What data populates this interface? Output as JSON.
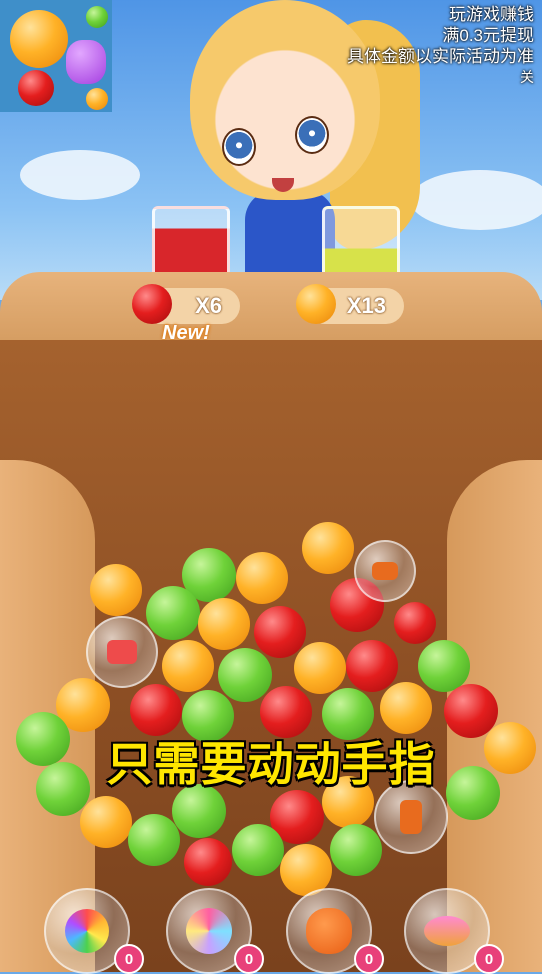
{
  "ad": {
    "line1": "玩游戏赚钱",
    "line2": "满0.3元提现",
    "line3": "具体金额以实际活动为准",
    "close": "关"
  },
  "orders": [
    {
      "fruit": "apple",
      "count": "X6",
      "juice_color": "#d8262b"
    },
    {
      "fruit": "orange",
      "count": "X13",
      "juice_color": "#d7e24a"
    }
  ],
  "new_label": "New!",
  "caption": "只需要动动手指",
  "boosters": [
    {
      "name": "rainbow-flower-booster",
      "count": "0"
    },
    {
      "name": "rainbow-swirl-booster",
      "count": "0"
    },
    {
      "name": "apple-jar-booster",
      "count": "0"
    },
    {
      "name": "spinning-top-booster",
      "count": "0"
    }
  ],
  "colors": {
    "caption": "#ffe600",
    "badge": "#e8417a"
  }
}
